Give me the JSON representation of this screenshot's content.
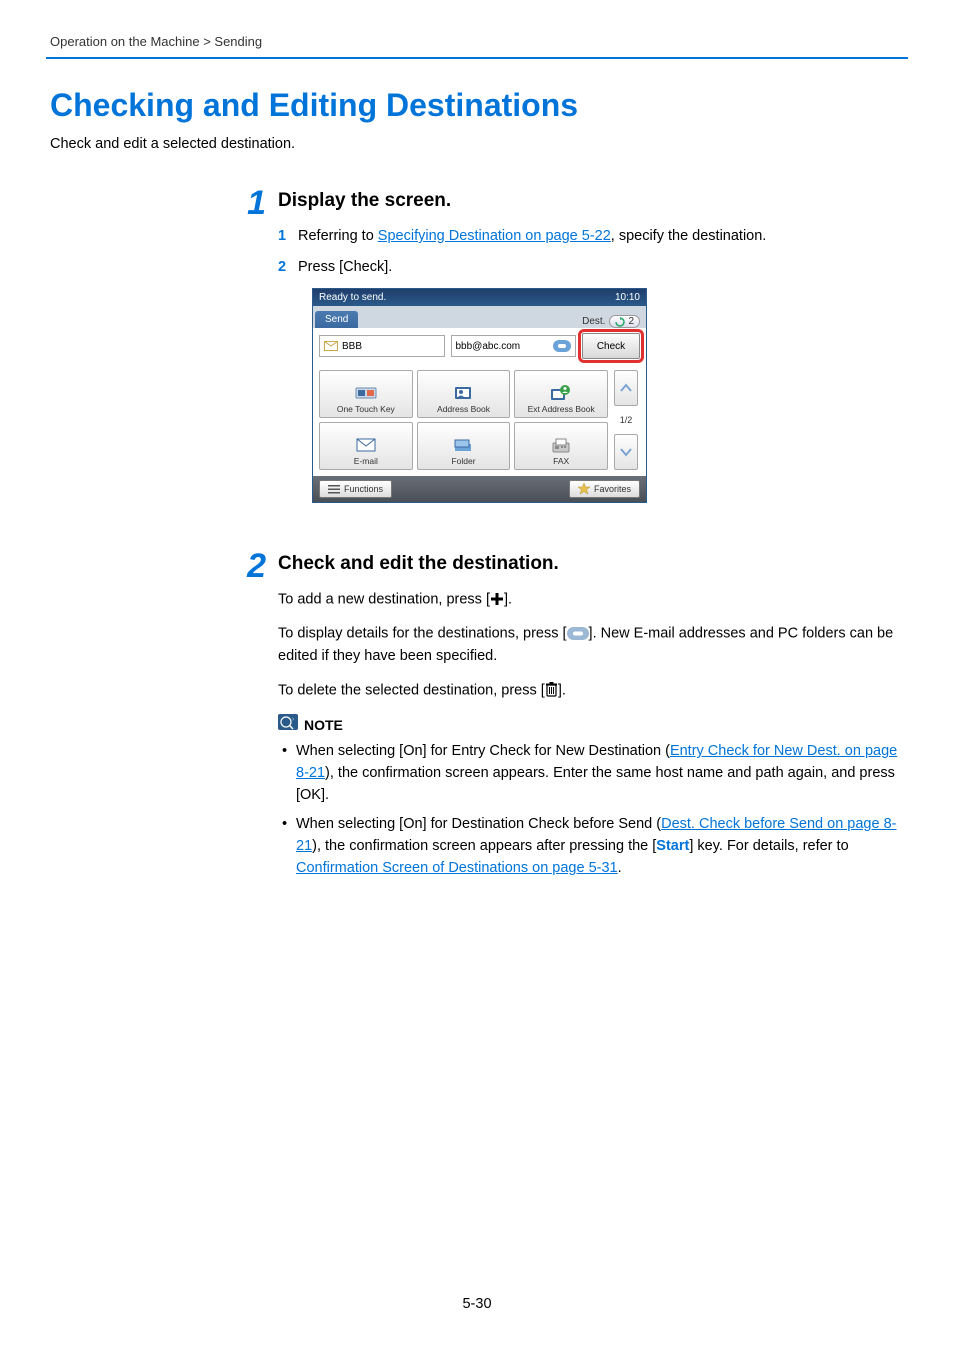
{
  "breadcrumb": "Operation on the Machine > Sending",
  "title": "Checking and Editing Destinations",
  "intro": "Check and edit a selected destination.",
  "step1": {
    "num": "1",
    "heading": "Display the screen.",
    "sub1n": "1",
    "sub1_a": "Referring to ",
    "sub1_link": "Specifying Destination on page 5-22",
    "sub1_b": ", specify the destination.",
    "sub2n": "2",
    "sub2": "Press [Check]."
  },
  "screen": {
    "status": "Ready to send.",
    "time": "10:10",
    "tab": "Send",
    "dest_label": "Dest.",
    "dest_count": "2",
    "bbb": "BBB",
    "bbb_addr": "bbb@abc.com",
    "check": "Check",
    "btn_onetouch": "One Touch Key",
    "btn_addrbook": "Address Book",
    "btn_ext": "Ext Address Book",
    "btn_email": "E-mail",
    "btn_folder": "Folder",
    "btn_fax": "FAX",
    "pager": "1/2",
    "functions": "Functions",
    "favorites": "Favorites"
  },
  "step2": {
    "num": "2",
    "heading": "Check and edit the destination.",
    "p1_a": "To add a new destination, press [",
    "p1_b": "].",
    "p2_a": "To display details for the destinations, press [",
    "p2_b": "]. New E-mail addresses and PC folders can be edited if they have been specified.",
    "p3_a": "To delete the selected destination, press [",
    "p3_b": "]."
  },
  "note": {
    "label": "NOTE",
    "li1_a": "When selecting [On] for Entry Check for New Destination (",
    "li1_link": "Entry Check for New Dest. on page 8-21",
    "li1_b": "), the confirmation screen appears. Enter the same host name and path again, and press [OK].",
    "li2_a": "When selecting [On] for Destination Check before Send (",
    "li2_link": "Dest. Check before Send on page 8-21",
    "li2_b": "), the confirmation screen appears after pressing the [",
    "li2_start": "Start",
    "li2_c": "] key. For details, refer to ",
    "li2_link2": "Confirmation Screen of Destinations on page 5-31",
    "li2_d": "."
  },
  "pagenum": "5-30"
}
